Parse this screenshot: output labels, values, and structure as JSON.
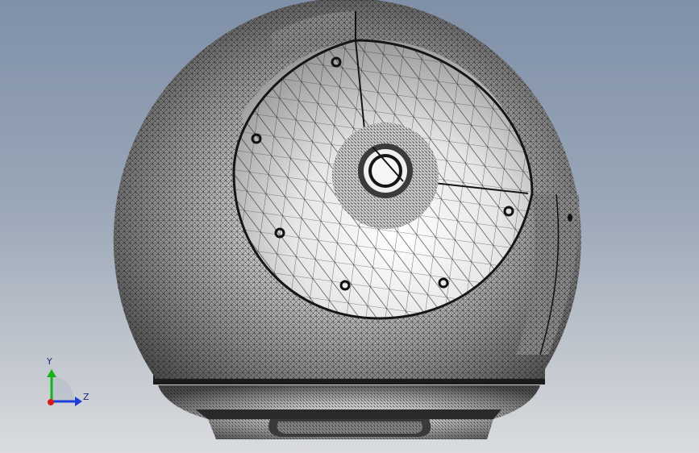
{
  "triad": {
    "y_label": "Y",
    "z_label": "Z",
    "colors": {
      "y": "#16b316",
      "z": "#1d3fd6",
      "x": "#d71a1a"
    }
  },
  "model": {
    "shade_light": "#f4f4f4",
    "shade_dark": "#4a4a4a",
    "mesh_color": "#1e1e1e"
  }
}
